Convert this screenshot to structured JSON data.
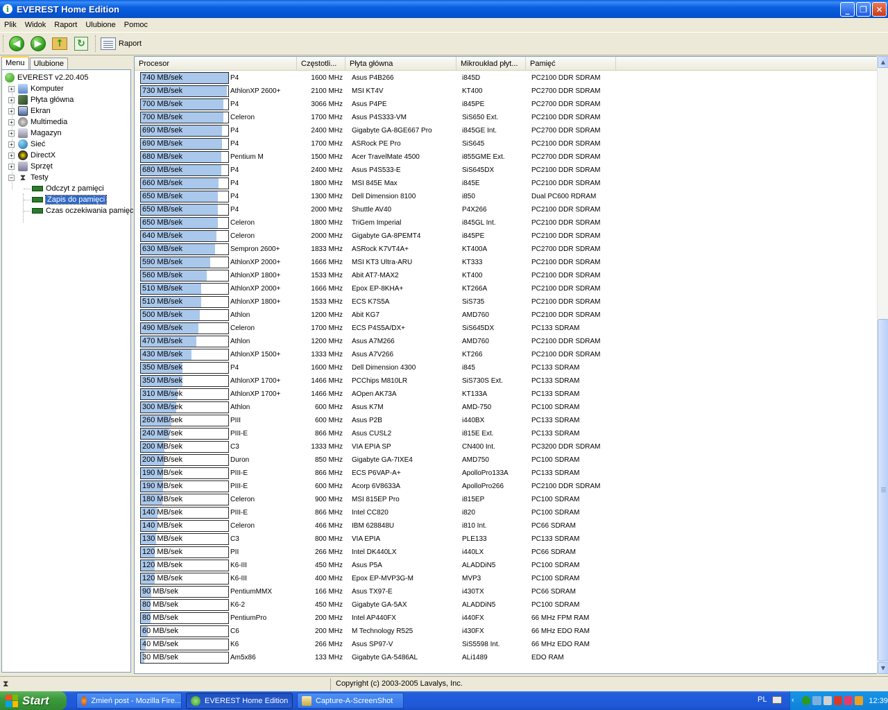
{
  "window": {
    "title": "EVEREST Home Edition"
  },
  "menu": [
    "Plik",
    "Widok",
    "Raport",
    "Ulubione",
    "Pomoc"
  ],
  "toolbar": {
    "report_label": "Raport"
  },
  "left": {
    "tabs": [
      "Menu",
      "Ulubione"
    ],
    "tree": {
      "root": "EVEREST v2.20.405",
      "items": [
        "Komputer",
        "Płyta główna",
        "Ekran",
        "Multimedia",
        "Magazyn",
        "Sieć",
        "DirectX",
        "Sprzęt",
        "Testy"
      ],
      "tests": [
        "Odczyt z pamięci",
        "Zapis do pamięci",
        "Czas oczekiwania pamięci"
      ],
      "selected": "Zapis do pamięci"
    }
  },
  "list": {
    "columns": [
      "Procesor",
      "Częstotli...",
      "Płyta główna",
      "Mikroukład płyt...",
      "Pamięć"
    ],
    "max_value": 740,
    "rows": [
      {
        "v": 740,
        "label": "740 MB/sek",
        "cpu": "P4",
        "clk": "1600 MHz",
        "mb": "Asus P4B266",
        "chip": "i845D",
        "mem": "PC2100 DDR SDRAM"
      },
      {
        "v": 730,
        "label": "730 MB/sek",
        "cpu": "AthlonXP 2600+",
        "clk": "2100 MHz",
        "mb": "MSI KT4V",
        "chip": "KT400",
        "mem": "PC2700 DDR SDRAM"
      },
      {
        "v": 700,
        "label": "700 MB/sek",
        "cpu": "P4",
        "clk": "3066 MHz",
        "mb": "Asus P4PE",
        "chip": "i845PE",
        "mem": "PC2700 DDR SDRAM"
      },
      {
        "v": 700,
        "label": "700 MB/sek",
        "cpu": "Celeron",
        "clk": "1700 MHz",
        "mb": "Asus P4S333-VM",
        "chip": "SiS650 Ext.",
        "mem": "PC2100 DDR SDRAM"
      },
      {
        "v": 690,
        "label": "690 MB/sek",
        "cpu": "P4",
        "clk": "2400 MHz",
        "mb": "Gigabyte GA-8GE667 Pro",
        "chip": "i845GE Int.",
        "mem": "PC2700 DDR SDRAM"
      },
      {
        "v": 690,
        "label": "690 MB/sek",
        "cpu": "P4",
        "clk": "1700 MHz",
        "mb": "ASRock PE Pro",
        "chip": "SiS645",
        "mem": "PC2100 DDR SDRAM"
      },
      {
        "v": 680,
        "label": "680 MB/sek",
        "cpu": "Pentium M",
        "clk": "1500 MHz",
        "mb": "Acer TravelMate 4500",
        "chip": "i855GME Ext.",
        "mem": "PC2700 DDR SDRAM"
      },
      {
        "v": 680,
        "label": "680 MB/sek",
        "cpu": "P4",
        "clk": "2400 MHz",
        "mb": "Asus P4S533-E",
        "chip": "SiS645DX",
        "mem": "PC2100 DDR SDRAM"
      },
      {
        "v": 660,
        "label": "660 MB/sek",
        "cpu": "P4",
        "clk": "1800 MHz",
        "mb": "MSI 845E Max",
        "chip": "i845E",
        "mem": "PC2100 DDR SDRAM"
      },
      {
        "v": 650,
        "label": "650 MB/sek",
        "cpu": "P4",
        "clk": "1300 MHz",
        "mb": "Dell Dimension 8100",
        "chip": "i850",
        "mem": "Dual PC600 RDRAM"
      },
      {
        "v": 650,
        "label": "650 MB/sek",
        "cpu": "P4",
        "clk": "2000 MHz",
        "mb": "Shuttle AV40",
        "chip": "P4X266",
        "mem": "PC2100 DDR SDRAM"
      },
      {
        "v": 650,
        "label": "650 MB/sek",
        "cpu": "Celeron",
        "clk": "1800 MHz",
        "mb": "TriGem Imperial",
        "chip": "i845GL Int.",
        "mem": "PC2100 DDR SDRAM"
      },
      {
        "v": 640,
        "label": "640 MB/sek",
        "cpu": "Celeron",
        "clk": "2000 MHz",
        "mb": "Gigabyte GA-8PEMT4",
        "chip": "i845PE",
        "mem": "PC2100 DDR SDRAM"
      },
      {
        "v": 630,
        "label": "630 MB/sek",
        "cpu": "Sempron 2600+",
        "clk": "1833 MHz",
        "mb": "ASRock K7VT4A+",
        "chip": "KT400A",
        "mem": "PC2700 DDR SDRAM"
      },
      {
        "v": 590,
        "label": "590 MB/sek",
        "cpu": "AthlonXP 2000+",
        "clk": "1666 MHz",
        "mb": "MSI KT3 Ultra-ARU",
        "chip": "KT333",
        "mem": "PC2100 DDR SDRAM"
      },
      {
        "v": 560,
        "label": "560 MB/sek",
        "cpu": "AthlonXP 1800+",
        "clk": "1533 MHz",
        "mb": "Abit AT7-MAX2",
        "chip": "KT400",
        "mem": "PC2100 DDR SDRAM"
      },
      {
        "v": 510,
        "label": "510 MB/sek",
        "cpu": "AthlonXP 2000+",
        "clk": "1666 MHz",
        "mb": "Epox EP-8KHA+",
        "chip": "KT266A",
        "mem": "PC2100 DDR SDRAM"
      },
      {
        "v": 510,
        "label": "510 MB/sek",
        "cpu": "AthlonXP 1800+",
        "clk": "1533 MHz",
        "mb": "ECS K7S5A",
        "chip": "SiS735",
        "mem": "PC2100 DDR SDRAM"
      },
      {
        "v": 500,
        "label": "500 MB/sek",
        "cpu": "Athlon",
        "clk": "1200 MHz",
        "mb": "Abit KG7",
        "chip": "AMD760",
        "mem": "PC2100 DDR SDRAM"
      },
      {
        "v": 490,
        "label": "490 MB/sek",
        "cpu": "Celeron",
        "clk": "1700 MHz",
        "mb": "ECS P4S5A/DX+",
        "chip": "SiS645DX",
        "mem": "PC133 SDRAM"
      },
      {
        "v": 470,
        "label": "470 MB/sek",
        "cpu": "Athlon",
        "clk": "1200 MHz",
        "mb": "Asus A7M266",
        "chip": "AMD760",
        "mem": "PC2100 DDR SDRAM"
      },
      {
        "v": 430,
        "label": "430 MB/sek",
        "cpu": "AthlonXP 1500+",
        "clk": "1333 MHz",
        "mb": "Asus A7V266",
        "chip": "KT266",
        "mem": "PC2100 DDR SDRAM"
      },
      {
        "v": 350,
        "label": "350 MB/sek",
        "cpu": "P4",
        "clk": "1600 MHz",
        "mb": "Dell Dimension 4300",
        "chip": "i845",
        "mem": "PC133 SDRAM"
      },
      {
        "v": 350,
        "label": "350 MB/sek",
        "cpu": "AthlonXP 1700+",
        "clk": "1466 MHz",
        "mb": "PCChips M810LR",
        "chip": "SiS730S Ext.",
        "mem": "PC133 SDRAM"
      },
      {
        "v": 310,
        "label": "310 MB/sek",
        "cpu": "AthlonXP 1700+",
        "clk": "1466 MHz",
        "mb": "AOpen AK73A",
        "chip": "KT133A",
        "mem": "PC133 SDRAM"
      },
      {
        "v": 300,
        "label": "300 MB/sek",
        "cpu": "Athlon",
        "clk": "600 MHz",
        "mb": "Asus K7M",
        "chip": "AMD-750",
        "mem": "PC100 SDRAM"
      },
      {
        "v": 260,
        "label": "260 MB/sek",
        "cpu": "PIII",
        "clk": "600 MHz",
        "mb": "Asus P2B",
        "chip": "i440BX",
        "mem": "PC133 SDRAM"
      },
      {
        "v": 240,
        "label": "240 MB/sek",
        "cpu": "PIII-E",
        "clk": "866 MHz",
        "mb": "Asus CUSL2",
        "chip": "i815E Ext.",
        "mem": "PC133 SDRAM"
      },
      {
        "v": 200,
        "label": "200 MB/sek",
        "cpu": "C3",
        "clk": "1333 MHz",
        "mb": "VIA EPIA SP",
        "chip": "CN400 Int.",
        "mem": "PC3200 DDR SDRAM"
      },
      {
        "v": 200,
        "label": "200 MB/sek",
        "cpu": "Duron",
        "clk": "850 MHz",
        "mb": "Gigabyte GA-7IXE4",
        "chip": "AMD750",
        "mem": "PC100 SDRAM"
      },
      {
        "v": 190,
        "label": "190 MB/sek",
        "cpu": "PIII-E",
        "clk": "866 MHz",
        "mb": "ECS P6VAP-A+",
        "chip": "ApolloPro133A",
        "mem": "PC133 SDRAM"
      },
      {
        "v": 190,
        "label": "190 MB/sek",
        "cpu": "PIII-E",
        "clk": "600 MHz",
        "mb": "Acorp 6V8633A",
        "chip": "ApolloPro266",
        "mem": "PC2100 DDR SDRAM"
      },
      {
        "v": 180,
        "label": "180 MB/sek",
        "cpu": "Celeron",
        "clk": "900 MHz",
        "mb": "MSI 815EP Pro",
        "chip": "i815EP",
        "mem": "PC100 SDRAM"
      },
      {
        "v": 140,
        "label": "140 MB/sek",
        "cpu": "PIII-E",
        "clk": "866 MHz",
        "mb": "Intel CC820",
        "chip": "i820",
        "mem": "PC100 SDRAM"
      },
      {
        "v": 140,
        "label": "140 MB/sek",
        "cpu": "Celeron",
        "clk": "466 MHz",
        "mb": "IBM 628848U",
        "chip": "i810 Int.",
        "mem": "PC66 SDRAM"
      },
      {
        "v": 130,
        "label": "130 MB/sek",
        "cpu": "C3",
        "clk": "800 MHz",
        "mb": "VIA EPIA",
        "chip": "PLE133",
        "mem": "PC133 SDRAM"
      },
      {
        "v": 120,
        "label": "120 MB/sek",
        "cpu": "PII",
        "clk": "266 MHz",
        "mb": "Intel DK440LX",
        "chip": "i440LX",
        "mem": "PC66 SDRAM"
      },
      {
        "v": 120,
        "label": "120 MB/sek",
        "cpu": "K6-III",
        "clk": "450 MHz",
        "mb": "Asus P5A",
        "chip": "ALADDiN5",
        "mem": "PC100 SDRAM"
      },
      {
        "v": 120,
        "label": "120 MB/sek",
        "cpu": "K6-III",
        "clk": "400 MHz",
        "mb": "Epox EP-MVP3G-M",
        "chip": "MVP3",
        "mem": "PC100 SDRAM"
      },
      {
        "v": 90,
        "label": "90 MB/sek",
        "cpu": "PentiumMMX",
        "clk": "166 MHz",
        "mb": "Asus TX97-E",
        "chip": "i430TX",
        "mem": "PC66 SDRAM"
      },
      {
        "v": 80,
        "label": "80 MB/sek",
        "cpu": "K6-2",
        "clk": "450 MHz",
        "mb": "Gigabyte GA-5AX",
        "chip": "ALADDiN5",
        "mem": "PC100 SDRAM"
      },
      {
        "v": 80,
        "label": "80 MB/sek",
        "cpu": "PentiumPro",
        "clk": "200 MHz",
        "mb": "Intel AP440FX",
        "chip": "i440FX",
        "mem": "66 MHz FPM RAM"
      },
      {
        "v": 60,
        "label": "60 MB/sek",
        "cpu": "C6",
        "clk": "200 MHz",
        "mb": "M Technology R525",
        "chip": "i430FX",
        "mem": "66 MHz EDO RAM"
      },
      {
        "v": 40,
        "label": "40 MB/sek",
        "cpu": "K6",
        "clk": "266 MHz",
        "mb": "Asus SP97-V",
        "chip": "SiS5598 Int.",
        "mem": "66 MHz EDO RAM"
      },
      {
        "v": 30,
        "label": "30 MB/sek",
        "cpu": "Am5x86",
        "clk": "133 MHz",
        "mb": "Gigabyte GA-5486AL",
        "chip": "ALi1489",
        "mem": "EDO RAM"
      }
    ]
  },
  "status": {
    "copyright": "Copyright (c) 2003-2005 Lavalys, Inc."
  },
  "taskbar": {
    "start": "Start",
    "tasks": [
      "Zmień post - Mozilla Fire...",
      "EVEREST Home Edition",
      "Capture-A-ScreenShot"
    ],
    "lang": "PL",
    "clock": "12:39"
  }
}
